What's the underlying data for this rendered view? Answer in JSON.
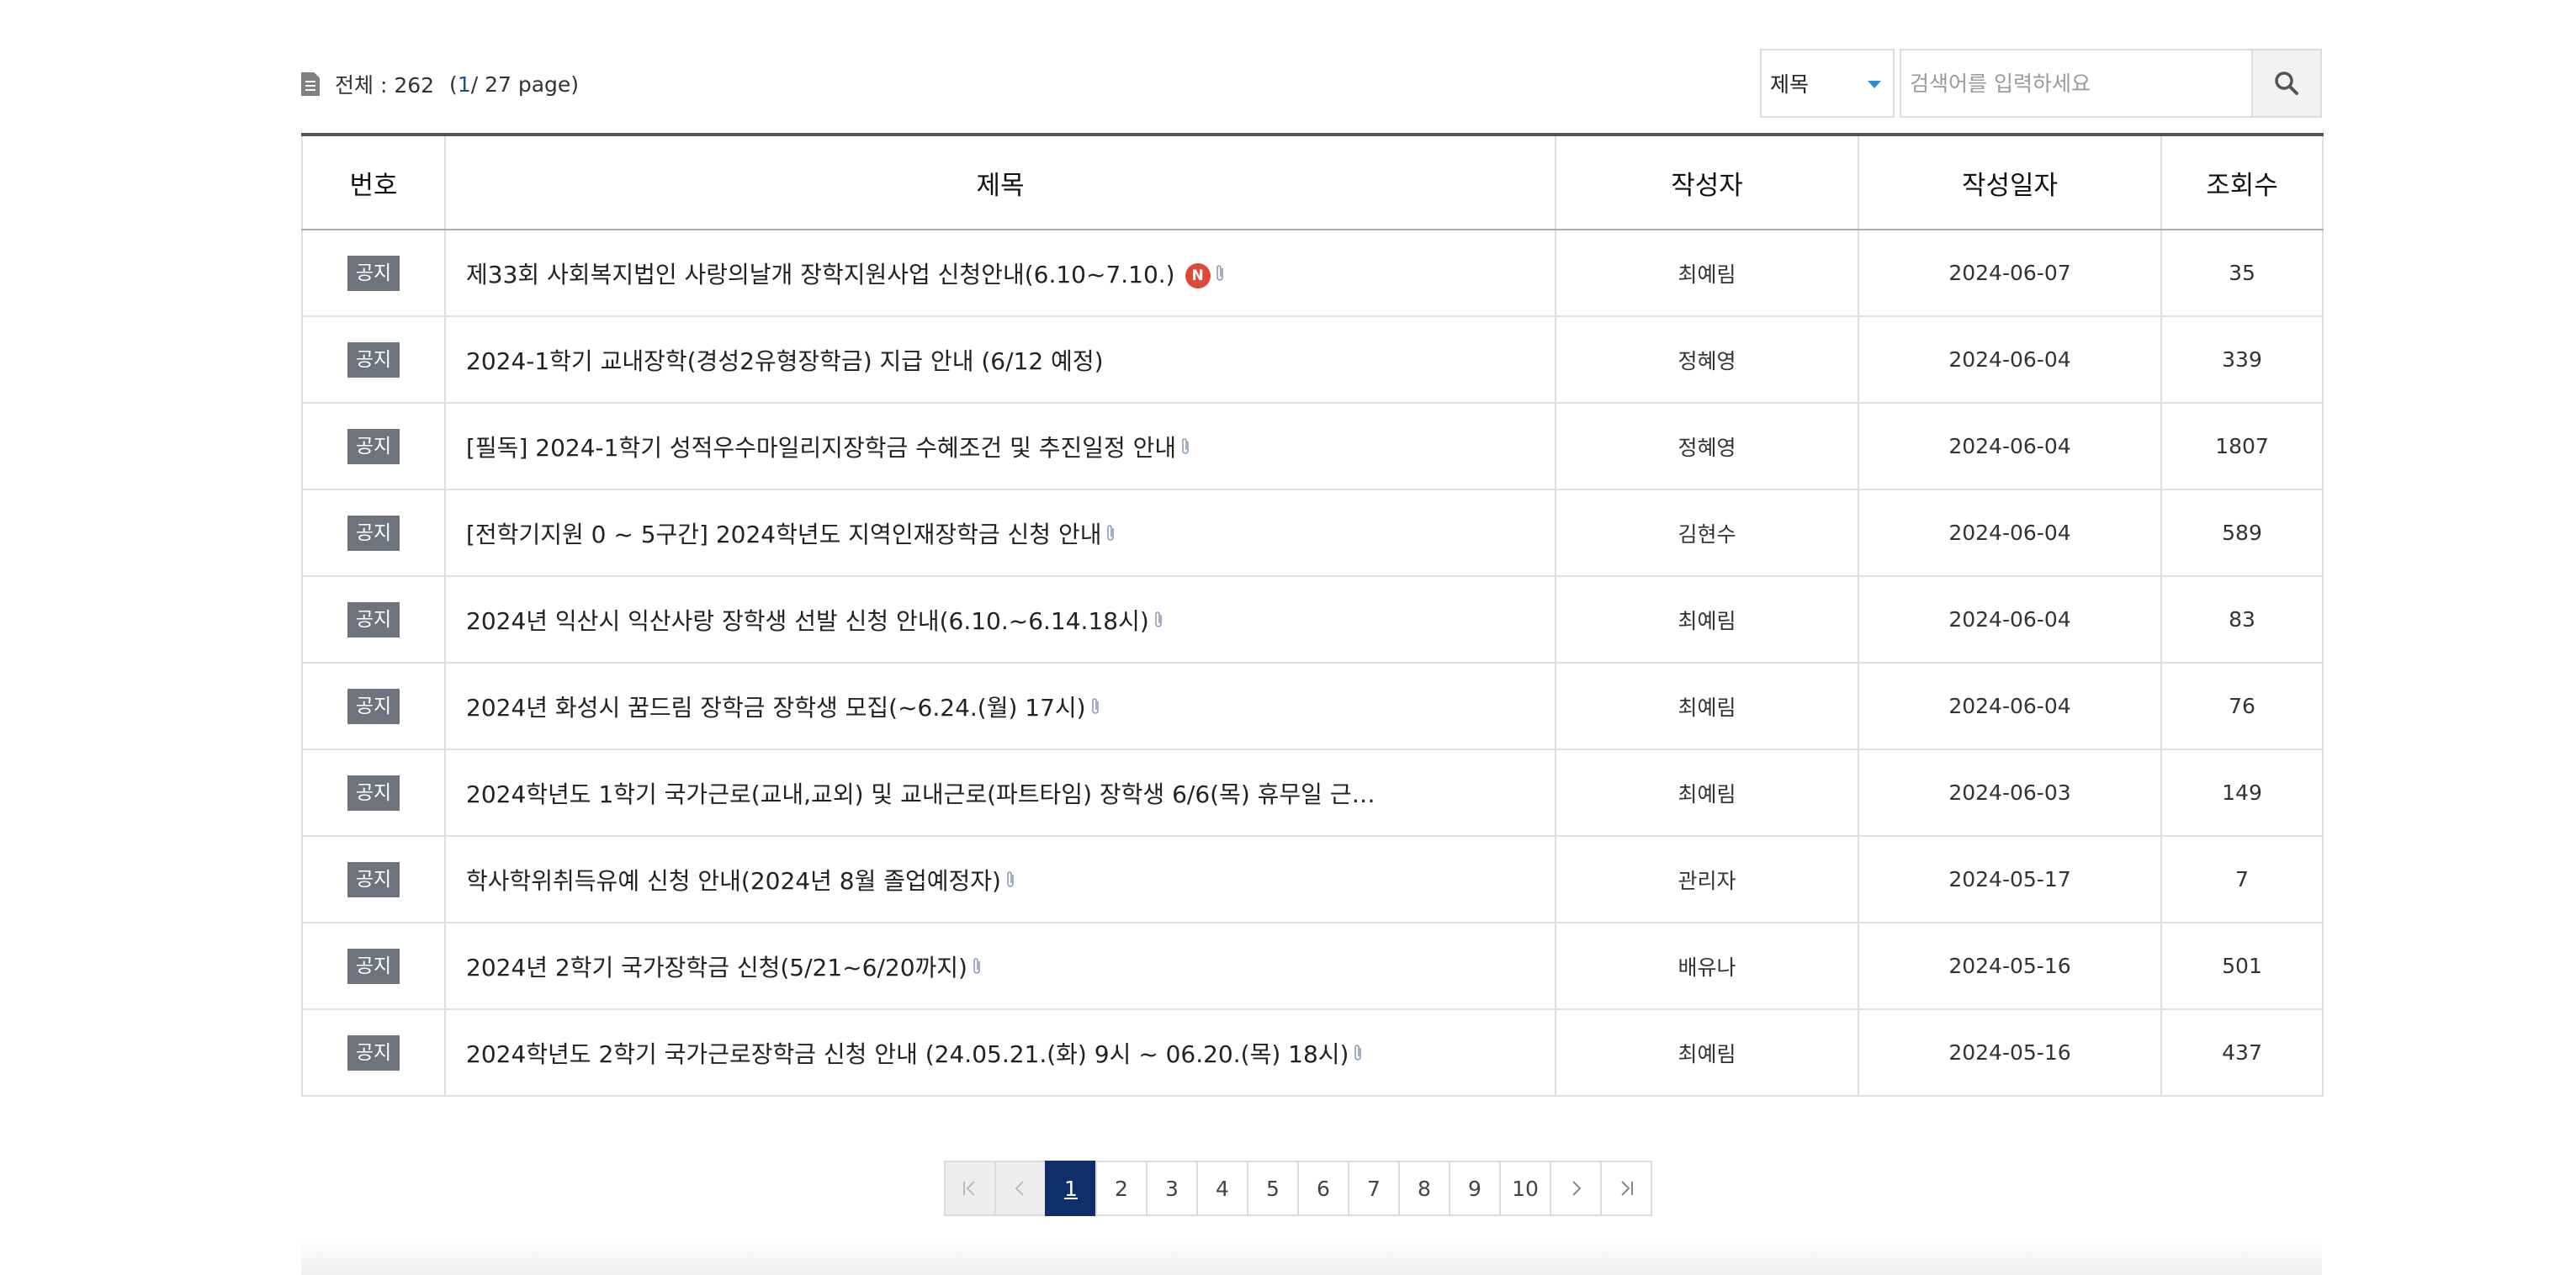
{
  "summary": {
    "total_label": "전체 : 262",
    "page_open": "(",
    "current_page": "1",
    "page_rest": " / 27 page)"
  },
  "search": {
    "field_select": "제목",
    "placeholder": "검색어를 입력하세요"
  },
  "table": {
    "headers": [
      "번호",
      "제목",
      "작성자",
      "작성일자",
      "조회수"
    ],
    "rows": [
      {
        "badge": "공지",
        "title": "제33회 사회복지법인 사랑의날개 장학지원사업 신청안내(6.10~7.10.)",
        "new": "N",
        "attachment": true,
        "author": "최예림",
        "date": "2024-06-07",
        "views": "35"
      },
      {
        "badge": "공지",
        "title": "2024-1학기 교내장학(경성2유형장학금) 지급 안내 (6/12 예정)",
        "attachment": false,
        "author": "정혜영",
        "date": "2024-06-04",
        "views": "339"
      },
      {
        "badge": "공지",
        "title": "[필독] 2024-1학기 성적우수마일리지장학금 수혜조건 및 추진일정 안내",
        "attachment": true,
        "author": "정혜영",
        "date": "2024-06-04",
        "views": "1807"
      },
      {
        "badge": "공지",
        "title": "[전학기지원 0 ~ 5구간] 2024학년도 지역인재장학금 신청 안내",
        "attachment": true,
        "author": "김현수",
        "date": "2024-06-04",
        "views": "589"
      },
      {
        "badge": "공지",
        "title": "2024년 익산시 익산사랑 장학생 선발 신청 안내(6.10.~6.14.18시)",
        "attachment": true,
        "author": "최예림",
        "date": "2024-06-04",
        "views": "83"
      },
      {
        "badge": "공지",
        "title": "2024년 화성시 꿈드림 장학금 장학생 모집(~6.24.(월) 17시)",
        "attachment": true,
        "author": "최예림",
        "date": "2024-06-04",
        "views": "76"
      },
      {
        "badge": "공지",
        "title": "2024학년도 1학기 국가근로(교내,교외) 및 교내근로(파트타임) 장학생 6/6(목) 휴무일 근…",
        "attachment": false,
        "author": "최예림",
        "date": "2024-06-03",
        "views": "149"
      },
      {
        "badge": "공지",
        "title": "학사학위취득유예 신청 안내(2024년 8월 졸업예정자)",
        "attachment": true,
        "author": "관리자",
        "date": "2024-05-17",
        "views": "7"
      },
      {
        "badge": "공지",
        "title": "2024년 2학기 국가장학금 신청(5/21~6/20까지)",
        "attachment": true,
        "author": "배유나",
        "date": "2024-05-16",
        "views": "501"
      },
      {
        "badge": "공지",
        "title": "2024학년도 2학기 국가근로장학금 신청 안내 (24.05.21.(화) 9시 ~ 06.20.(목) 18시)",
        "attachment": true,
        "author": "최예림",
        "date": "2024-05-16",
        "views": "437"
      }
    ]
  },
  "pagination": {
    "first_icon": "first-page-icon",
    "prev_icon": "prev-page-icon",
    "pages": [
      "1",
      "2",
      "3",
      "4",
      "5",
      "6",
      "7",
      "8",
      "9",
      "10"
    ],
    "current": "1",
    "next_icon": "next-page-icon",
    "last_icon": "last-page-icon"
  },
  "colors": {
    "badge": "#6d747d",
    "current_page": "#0f2f6b",
    "new_icon": "#e04a3a",
    "select_caret": "#2a8fd2",
    "page_number_highlight": "#1f4e99"
  }
}
